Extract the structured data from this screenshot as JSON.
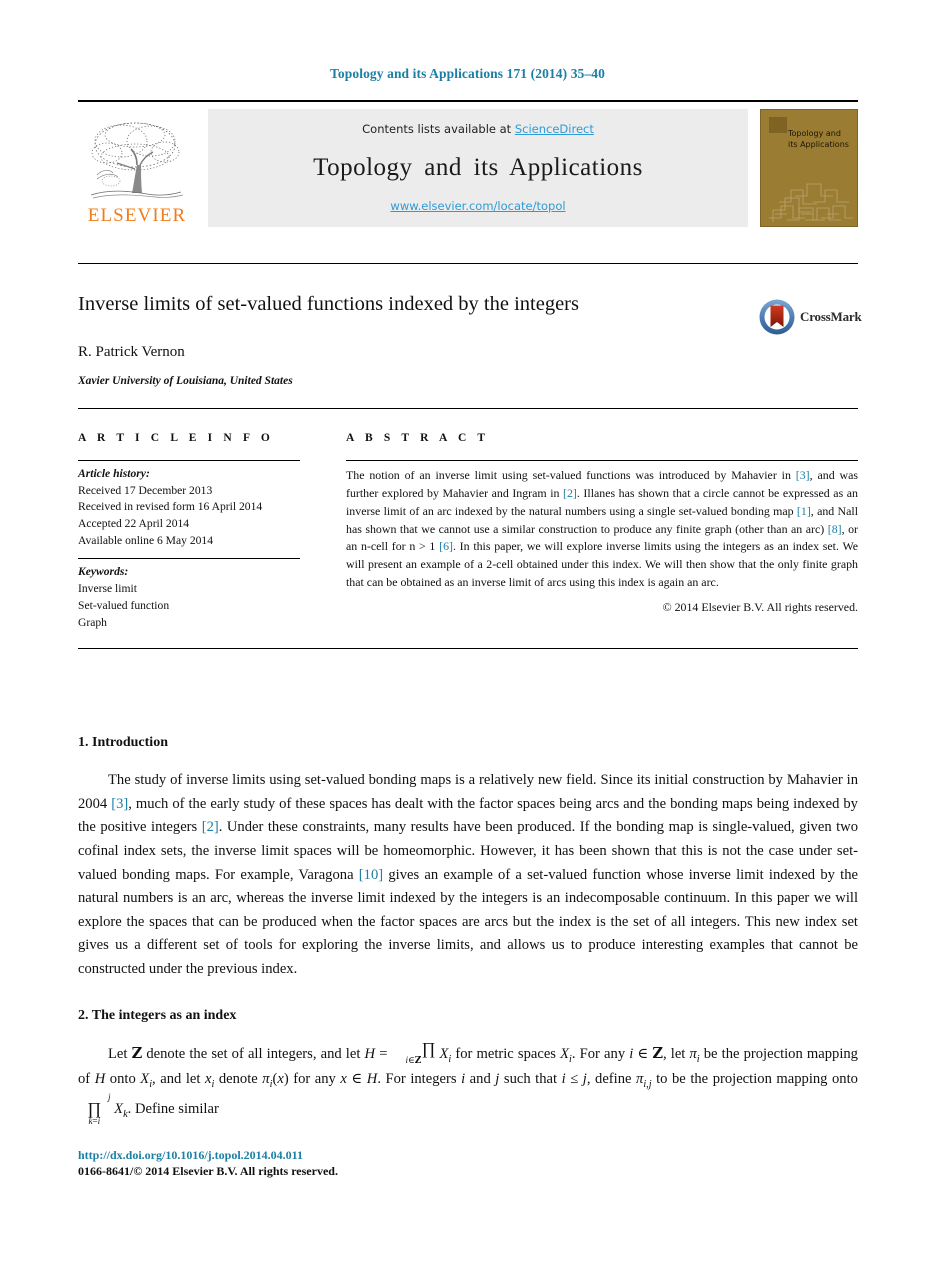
{
  "running_head": "Topology and its Applications 171 (2014) 35–40",
  "masthead": {
    "contents_prefix": "Contents lists available at ",
    "sciencedirect": "ScienceDirect",
    "journal_title": "Topology and its Applications",
    "journal_url": "www.elsevier.com/locate/topol",
    "publisher_wordmark": "ELSEVIER",
    "cover_title": "Topology and its Applications",
    "link_color": "#2e9bd6",
    "cover_color": "#9b7c33",
    "wordmark_color": "#ef7d1a"
  },
  "article": {
    "title": "Inverse limits of set-valued functions indexed by the integers",
    "author": "R. Patrick Vernon",
    "affiliation": "Xavier University of Louisiana, United States",
    "crossmark_label": "CrossMark"
  },
  "info": {
    "heading": "A R T I C L E   I N F O",
    "history_label": "Article history:",
    "history": [
      "Received 17 December 2013",
      "Received in revised form 16 April 2014",
      "Accepted 22 April 2014",
      "Available online 6 May 2014"
    ],
    "keywords_label": "Keywords:",
    "keywords": [
      "Inverse limit",
      "Set-valued function",
      "Graph"
    ]
  },
  "abstract": {
    "heading": "A B S T R A C T",
    "parts": [
      {
        "t": "The notion of an inverse limit using set-valued functions was introduced by Mahavier in "
      },
      {
        "t": "[3]",
        "cite": true
      },
      {
        "t": ", and was further explored by Mahavier and Ingram in "
      },
      {
        "t": "[2]",
        "cite": true
      },
      {
        "t": ". Illanes has shown that a circle cannot be expressed as an inverse limit of an arc indexed by the natural numbers using a single set-valued bonding map "
      },
      {
        "t": "[1]",
        "cite": true
      },
      {
        "t": ", and Nall has shown that we cannot use a similar construction to produce any finite graph (other than an arc) "
      },
      {
        "t": "[8]",
        "cite": true
      },
      {
        "t": ", or an n-cell for n > 1 "
      },
      {
        "t": "[6]",
        "cite": true
      },
      {
        "t": ". In this paper, we will explore inverse limits using the integers as an index set. We will present an example of a 2-cell obtained under this index. We will then show that the only finite graph that can be obtained as an inverse limit of arcs using this index is again an arc."
      }
    ],
    "copyright": "© 2014 Elsevier B.V. All rights reserved."
  },
  "sections": [
    {
      "heading": "1. Introduction",
      "paragraph_parts": [
        {
          "t": "The study of inverse limits using set-valued bonding maps is a relatively new field. Since its initial construction by Mahavier in 2004 "
        },
        {
          "t": "[3]",
          "cite": true
        },
        {
          "t": ", much of the early study of these spaces has dealt with the factor spaces being arcs and the bonding maps being indexed by the positive integers "
        },
        {
          "t": "[2]",
          "cite": true
        },
        {
          "t": ". Under these constraints, many results have been produced. If the bonding map is single-valued, given two cofinal index sets, the inverse limit spaces will be homeomorphic. However, it has been shown that this is not the case under set-valued bonding maps. For example, Varagona "
        },
        {
          "t": "[10]",
          "cite": true
        },
        {
          "t": " gives an example of a set-valued function whose inverse limit indexed by the natural numbers is an arc, whereas the inverse limit indexed by the integers is an indecomposable continuum. In this paper we will explore the spaces that can be produced when the factor spaces are arcs but the index is the set of all integers. This new index set gives us a different set of tools for exploring the inverse limits, and allows us to produce interesting examples that cannot be constructed under the previous index."
        }
      ]
    },
    {
      "heading": "2. The integers as an index",
      "paragraph_text": "Let Z denote the set of all integers, and let H = ∏i∈Z Xi for metric spaces Xi. For any i ∈ Z, let πi be the projection mapping of H onto Xi, and let xi denote πi(x) for any x ∈ H. For integers i and j such that i ≤ j, define πi,j to be the projection mapping onto ∏jk=i Xk. Define similar"
    }
  ],
  "footer": {
    "doi": "http://dx.doi.org/10.1016/j.topol.2014.04.011",
    "issn_line": "0166-8641/© 2014 Elsevier B.V. All rights reserved."
  }
}
